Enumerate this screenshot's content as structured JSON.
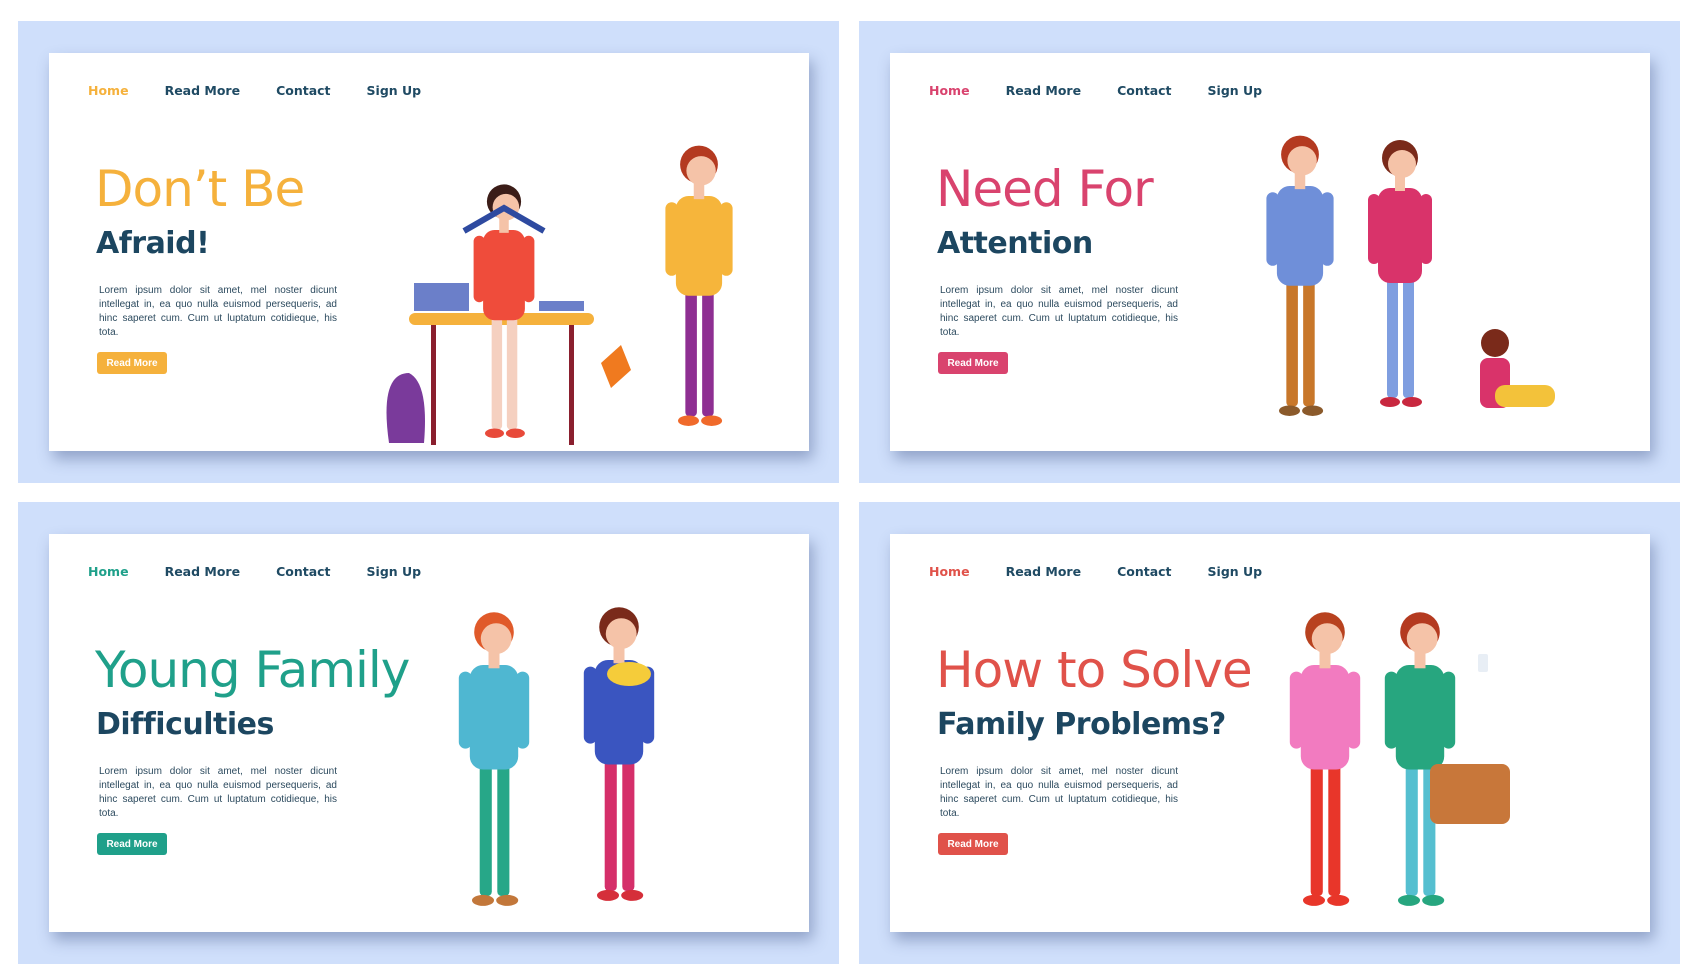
{
  "nav": {
    "home": "Home",
    "read_more": "Read More",
    "contact": "Contact",
    "sign_up": "Sign Up"
  },
  "paragraph": "Lorem ipsum dolor sit amet, mel noster dicunt intellegat in, ea quo nulla euismod persequeris, ad hinc saperet cum. Cum ut luptatum cotidieque, his tota.",
  "button_label": "Read More",
  "colors": {
    "panel_bg": "#cfdffb",
    "navy": "#1c4660"
  },
  "cards": [
    {
      "title": "Don’t Be",
      "subtitle": "Afraid!",
      "accent": "#f5b13c",
      "illustration": "girl-at-desk-with-book-and-pointing-boy"
    },
    {
      "title": "Need For",
      "subtitle": "Attention",
      "accent": "#d9436e",
      "illustration": "arguing-couple-and-sad-child"
    },
    {
      "title": "Young Family",
      "subtitle": "Difficulties",
      "accent": "#1fa08a",
      "illustration": "stressed-father-and-mother-with-baby"
    },
    {
      "title": "How to Solve",
      "subtitle": "Family Problems?",
      "accent": "#e0524a",
      "illustration": "upset-woman-and-man-with-phone-and-bag"
    }
  ]
}
